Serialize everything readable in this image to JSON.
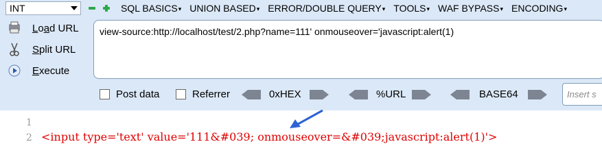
{
  "hackbar": {
    "select_value": "INT",
    "menu": [
      "SQL BASICS",
      "UNION BASED",
      "ERROR/DOUBLE QUERY",
      "TOOLS",
      "WAF BYPASS",
      "ENCODING"
    ],
    "load_url": "Load URL",
    "split_url": "Split URL",
    "execute": "Execute",
    "url_value": "view-source:http://localhost/test/2.php?name=111' onmouseover='javascript:alert(1)",
    "post_data": "Post data",
    "referrer": "Referrer",
    "hex": "0xHEX",
    "url_enc": "%URL",
    "base64": "BASE64",
    "insert_placeholder": "Insert s"
  },
  "source": {
    "line1": "1",
    "line2": "2",
    "code": "<input type='text' value='111&#039; onmouseover=&#039;javascript:alert(1)'>"
  },
  "colors": {
    "accent": "#2d62d6",
    "code": "#e00000",
    "bar": "#dbe8f7"
  }
}
